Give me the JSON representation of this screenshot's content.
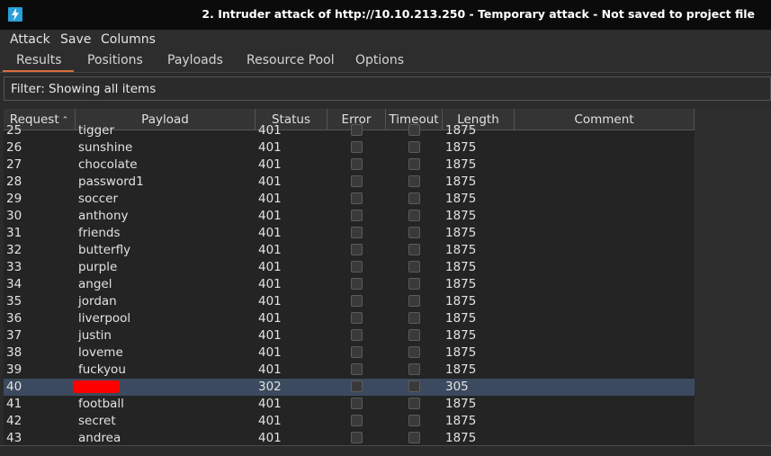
{
  "window": {
    "title": "2. Intruder attack of http://10.10.213.250 - Temporary attack - Not saved to project file",
    "icon": "lightning-icon",
    "accent": "#d86c3c"
  },
  "menu": [
    "Attack",
    "Save",
    "Columns"
  ],
  "tabs": [
    "Results",
    "Positions",
    "Payloads",
    "Resource Pool",
    "Options"
  ],
  "active_tab": "Results",
  "filter": "Filter: Showing all items",
  "table": {
    "columns": [
      "Request",
      "Payload",
      "Status",
      "Error",
      "Timeout",
      "Length",
      "Comment"
    ],
    "sort_column": "Request",
    "sort_direction": "ascending",
    "partial_top_row": {
      "request": "25",
      "payload": "tigger",
      "status": "401",
      "length": "1875"
    },
    "rows": [
      {
        "request": "26",
        "payload": "sunshine",
        "status": "401",
        "length": "1875"
      },
      {
        "request": "27",
        "payload": "chocolate",
        "status": "401",
        "length": "1875"
      },
      {
        "request": "28",
        "payload": "password1",
        "status": "401",
        "length": "1875"
      },
      {
        "request": "29",
        "payload": "soccer",
        "status": "401",
        "length": "1875"
      },
      {
        "request": "30",
        "payload": "anthony",
        "status": "401",
        "length": "1875"
      },
      {
        "request": "31",
        "payload": "friends",
        "status": "401",
        "length": "1875"
      },
      {
        "request": "32",
        "payload": "butterfly",
        "status": "401",
        "length": "1875"
      },
      {
        "request": "33",
        "payload": "purple",
        "status": "401",
        "length": "1875"
      },
      {
        "request": "34",
        "payload": "angel",
        "status": "401",
        "length": "1875"
      },
      {
        "request": "35",
        "payload": "jordan",
        "status": "401",
        "length": "1875"
      },
      {
        "request": "36",
        "payload": "liverpool",
        "status": "401",
        "length": "1875"
      },
      {
        "request": "37",
        "payload": "justin",
        "status": "401",
        "length": "1875"
      },
      {
        "request": "38",
        "payload": "loveme",
        "status": "401",
        "length": "1875"
      },
      {
        "request": "39",
        "payload": "fuckyou",
        "status": "401",
        "length": "1875"
      },
      {
        "request": "40",
        "payload": "",
        "status": "302",
        "length": "305",
        "selected": true,
        "redacted": true
      },
      {
        "request": "41",
        "payload": "football",
        "status": "401",
        "length": "1875"
      },
      {
        "request": "42",
        "payload": "secret",
        "status": "401",
        "length": "1875"
      },
      {
        "request": "43",
        "payload": "andrea",
        "status": "401",
        "length": "1875"
      }
    ]
  }
}
